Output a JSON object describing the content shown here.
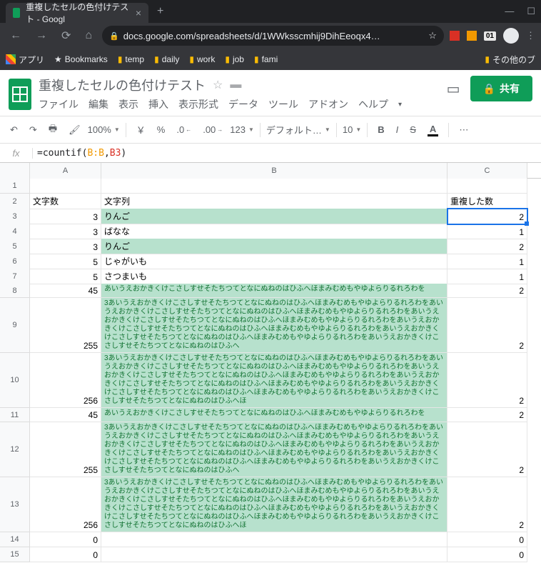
{
  "browser": {
    "tab_title": "重複したセルの色付けテスト - Googl",
    "url_display": "docs.google.com/spreadsheets/d/1WWksscmhij9DihEeoqx4…",
    "ext_badge": "01",
    "bookmarks": {
      "apps": "アプリ",
      "bookmarks": "Bookmarks",
      "temp": "temp",
      "daily": "daily",
      "work": "work",
      "job": "job",
      "fami": "fami",
      "other": "その他のブ"
    }
  },
  "doc": {
    "title": "重複したセルの色付けテスト",
    "menus": {
      "file": "ファイル",
      "edit": "編集",
      "view": "表示",
      "insert": "挿入",
      "format": "表示形式",
      "data": "データ",
      "tools": "ツール",
      "addons": "アドオン",
      "help": "ヘルプ"
    },
    "share": "共有"
  },
  "toolbar": {
    "zoom": "100%",
    "currency": "￥",
    "percent": "%",
    "dec_less": ".0",
    "dec_more": ".00",
    "fmt123": "123",
    "font": "デフォルト…",
    "size": "10"
  },
  "fx": {
    "prefix": "=countif(",
    "rng": "B:B",
    "comma": ",",
    "ref": "B3",
    "suffix": ")"
  },
  "cols": [
    "A",
    "B",
    "C"
  ],
  "headers": {
    "a": "文字数",
    "b": "文字列",
    "c": "重複した数"
  },
  "rows": [
    {
      "r": 3,
      "a": "3",
      "b": "りんご",
      "c": "2",
      "hl": true,
      "sel": true
    },
    {
      "r": 4,
      "a": "3",
      "b": "ばなな",
      "c": "1",
      "hl": false
    },
    {
      "r": 5,
      "a": "3",
      "b": "りんご",
      "c": "2",
      "hl": true
    },
    {
      "r": 6,
      "a": "5",
      "b": "じゃがいも",
      "c": "1",
      "hl": false
    },
    {
      "r": 7,
      "a": "5",
      "b": "さつまいも",
      "c": "1",
      "hl": false
    },
    {
      "r": 8,
      "a": "45",
      "b": "あいうえおかきくけこさしすせそたちつてとなにぬねのはひふへほまみむめもやゆよらりるれろわを",
      "c": "2",
      "hl": true,
      "long": true
    },
    {
      "r": 9,
      "a": "255",
      "b": "3あいうえおかきくけこさしすせそたちつてとなにぬねのはひふへほまみむめもやゆよらりるれろわをあいうえおかきくけこさしすせそたちつてとなにぬねのはひふへほまみむめもやゆよらりるれろわをあいうえおかきくけこさしすせそたちつてとなにぬねのはひふへほまみむめもやゆよらりるれろわをあいうえおかきくけこさしすせそたちつてとなにぬねのはひふへほまみむめもやゆよらりるれろわをあいうえおかきくけこさしすせそたちつてとなにぬねのはひふへほまみむめもやゆよらりるれろわをあいうえおかきくけこさしすせそたちつてとなにぬねのはひふへ",
      "c": "2",
      "hl": true,
      "long": true
    },
    {
      "r": 10,
      "a": "256",
      "b": "3あいうえおかきくけこさしすせそたちつてとなにぬねのはひふへほまみむめもやゆよらりるれろわをあいうえおかきくけこさしすせそたちつてとなにぬねのはひふへほまみむめもやゆよらりるれろわをあいうえおかきくけこさしすせそたちつてとなにぬねのはひふへほまみむめもやゆよらりるれろわをあいうえおかきくけこさしすせそたちつてとなにぬねのはひふへほまみむめもやゆよらりるれろわをあいうえおかきくけこさしすせそたちつてとなにぬねのはひふへほまみむめもやゆよらりるれろわをあいうえおかきくけこさしすせそたちつてとなにぬねのはひふへほ",
      "c": "2",
      "hl": true,
      "long": true
    },
    {
      "r": 11,
      "a": "45",
      "b": "あいうえおかきくけこさしすせそたちつてとなにぬねのはひふへほまみむめもやゆよらりるれろわを",
      "c": "2",
      "hl": true,
      "long": true
    },
    {
      "r": 12,
      "a": "255",
      "b": "3あいうえおかきくけこさしすせそたちつてとなにぬねのはひふへほまみむめもやゆよらりるれろわをあいうえおかきくけこさしすせそたちつてとなにぬねのはひふへほまみむめもやゆよらりるれろわをあいうえおかきくけこさしすせそたちつてとなにぬねのはひふへほまみむめもやゆよらりるれろわをあいうえおかきくけこさしすせそたちつてとなにぬねのはひふへほまみむめもやゆよらりるれろわをあいうえおかきくけこさしすせそたちつてとなにぬねのはひふへほまみむめもやゆよらりるれろわをあいうえおかきくけこさしすせそたちつてとなにぬねのはひふへ",
      "c": "2",
      "hl": true,
      "long": true
    },
    {
      "r": 13,
      "a": "256",
      "b": "3あいうえおかきくけこさしすせそたちつてとなにぬねのはひふへほまみむめもやゆよらりるれろわをあいうえおかきくけこさしすせそたちつてとなにぬねのはひふへほまみむめもやゆよらりるれろわをあいうえおかきくけこさしすせそたちつてとなにぬねのはひふへほまみむめもやゆよらりるれろわをあいうえおかきくけこさしすせそたちつてとなにぬねのはひふへほまみむめもやゆよらりるれろわをあいうえおかきくけこさしすせそたちつてとなにぬねのはひふへほまみむめもやゆよらりるれろわをあいうえおかきくけこさしすせそたちつてとなにぬねのはひふへほ",
      "c": "2",
      "hl": true,
      "long": true
    },
    {
      "r": 14,
      "a": "0",
      "b": "",
      "c": "0",
      "hl": false
    },
    {
      "r": 15,
      "a": "0",
      "b": "",
      "c": "0",
      "hl": false
    }
  ]
}
